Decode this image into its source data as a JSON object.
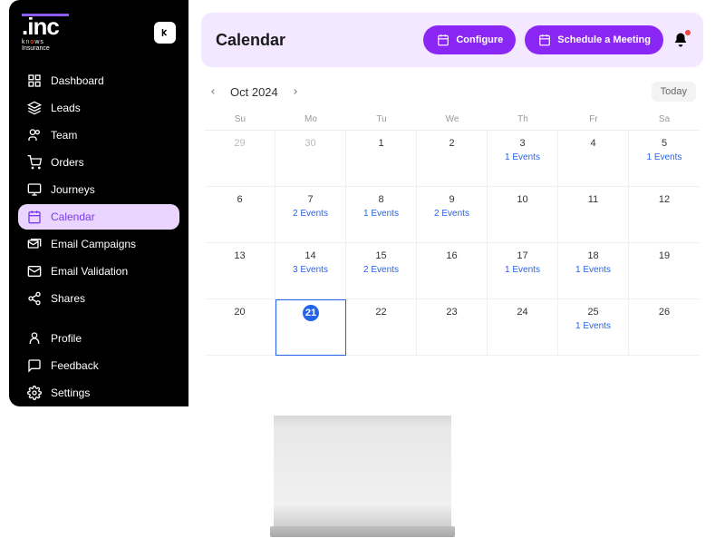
{
  "logo": {
    "main": ".inc",
    "tagline": "Insurance"
  },
  "sidebar": {
    "items": [
      {
        "label": "Dashboard",
        "icon": "grid"
      },
      {
        "label": "Leads",
        "icon": "layers"
      },
      {
        "label": "Team",
        "icon": "users"
      },
      {
        "label": "Orders",
        "icon": "cart"
      },
      {
        "label": "Journeys",
        "icon": "display"
      },
      {
        "label": "Calendar",
        "icon": "calendar",
        "active": true
      },
      {
        "label": "Email Campaigns",
        "icon": "mail-stack"
      },
      {
        "label": "Email Validation",
        "icon": "mail"
      },
      {
        "label": "Shares",
        "icon": "share"
      }
    ],
    "bottom": [
      {
        "label": "Profile",
        "icon": "user"
      },
      {
        "label": "Feedback",
        "icon": "chat"
      },
      {
        "label": "Settings",
        "icon": "gear"
      }
    ]
  },
  "header": {
    "title": "Calendar",
    "configure_label": "Configure",
    "schedule_label": "Schedule a Meeting"
  },
  "calendar": {
    "month_label": "Oct 2024",
    "today_label": "Today",
    "weekdays": [
      "Su",
      "Mo",
      "Tu",
      "We",
      "Th",
      "Fr",
      "Sa"
    ],
    "cells": [
      {
        "day": "29",
        "muted": true
      },
      {
        "day": "30",
        "muted": true
      },
      {
        "day": "1"
      },
      {
        "day": "2"
      },
      {
        "day": "3",
        "events": "1 Events"
      },
      {
        "day": "4"
      },
      {
        "day": "5",
        "events": "1 Events"
      },
      {
        "day": "6"
      },
      {
        "day": "7",
        "events": "2 Events"
      },
      {
        "day": "8",
        "events": "1 Events"
      },
      {
        "day": "9",
        "events": "2 Events"
      },
      {
        "day": "10"
      },
      {
        "day": "11"
      },
      {
        "day": "12"
      },
      {
        "day": "13"
      },
      {
        "day": "14",
        "events": "3 Events"
      },
      {
        "day": "15",
        "events": "2 Events"
      },
      {
        "day": "16"
      },
      {
        "day": "17",
        "events": "1 Events"
      },
      {
        "day": "18",
        "events": "1 Events"
      },
      {
        "day": "19"
      },
      {
        "day": "20"
      },
      {
        "day": "21",
        "today": true
      },
      {
        "day": "22"
      },
      {
        "day": "23"
      },
      {
        "day": "24"
      },
      {
        "day": "25",
        "events": "1 Events"
      },
      {
        "day": "26"
      }
    ]
  }
}
